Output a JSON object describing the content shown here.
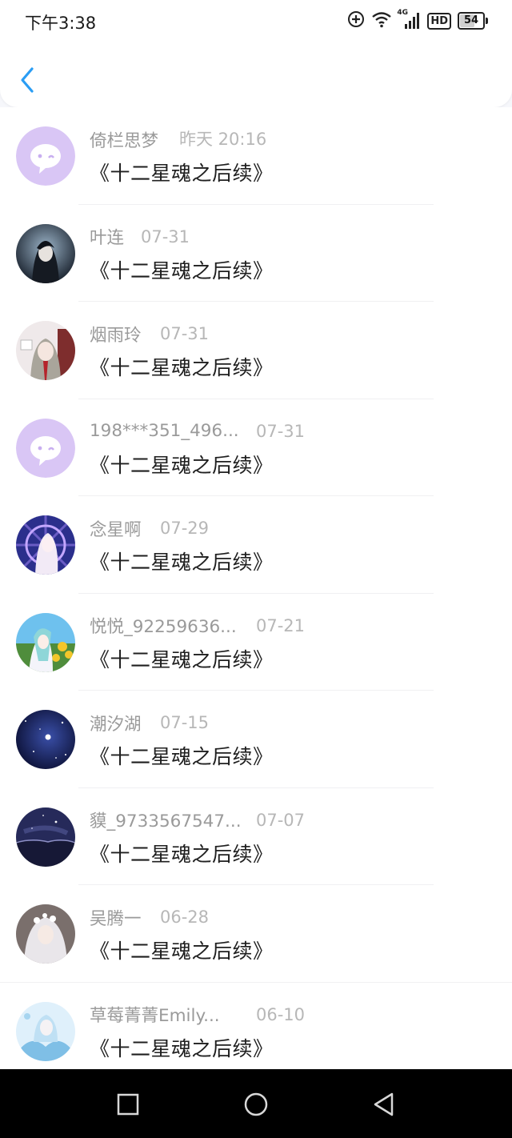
{
  "status_bar": {
    "time": "下午3:38",
    "network": "4G",
    "hd_label": "HD",
    "battery": "54"
  },
  "colors": {
    "accent": "#2a9df4",
    "name_text": "#9a9a9a",
    "message_text": "#1f1f1f",
    "default_avatar_bg": "#d9c6f5"
  },
  "messages": [
    {
      "name": "倚栏思梦",
      "time": "昨天 20:16",
      "text": "《十二星魂之后续》",
      "avatar": "default-chat-avatar"
    },
    {
      "name": "叶连",
      "time": "07-31",
      "text": "《十二星魂之后续》",
      "avatar": "dark-haired-anime-avatar"
    },
    {
      "name": "烟雨玲",
      "time": "07-31",
      "text": "《十二星魂之后续》",
      "avatar": "anime-girl-avatar"
    },
    {
      "name": "198***351_496...",
      "time": "07-31",
      "text": "《十二星魂之后续》",
      "avatar": "default-chat-avatar"
    },
    {
      "name": "念星啊",
      "time": "07-29",
      "text": "《十二星魂之后续》",
      "avatar": "stained-glass-anime-avatar"
    },
    {
      "name": "悦悦_92259636...",
      "time": "07-21",
      "text": "《十二星魂之后续》",
      "avatar": "sunflower-anime-avatar"
    },
    {
      "name": "潮汐湖",
      "time": "07-15",
      "text": "《十二星魂之后续》",
      "avatar": "starry-sky-avatar"
    },
    {
      "name": "貘_9733567547...",
      "time": "07-07",
      "text": "《十二星魂之后续》",
      "avatar": "night-lake-avatar"
    },
    {
      "name": "吴腾一",
      "time": "06-28",
      "text": "《十二星魂之后续》",
      "avatar": "white-haired-girl-avatar"
    },
    {
      "name": "草莓菁菁Emily...",
      "time": "06-10",
      "text": "《十二星魂之后续》",
      "avatar": "blue-anime-avatar"
    }
  ]
}
